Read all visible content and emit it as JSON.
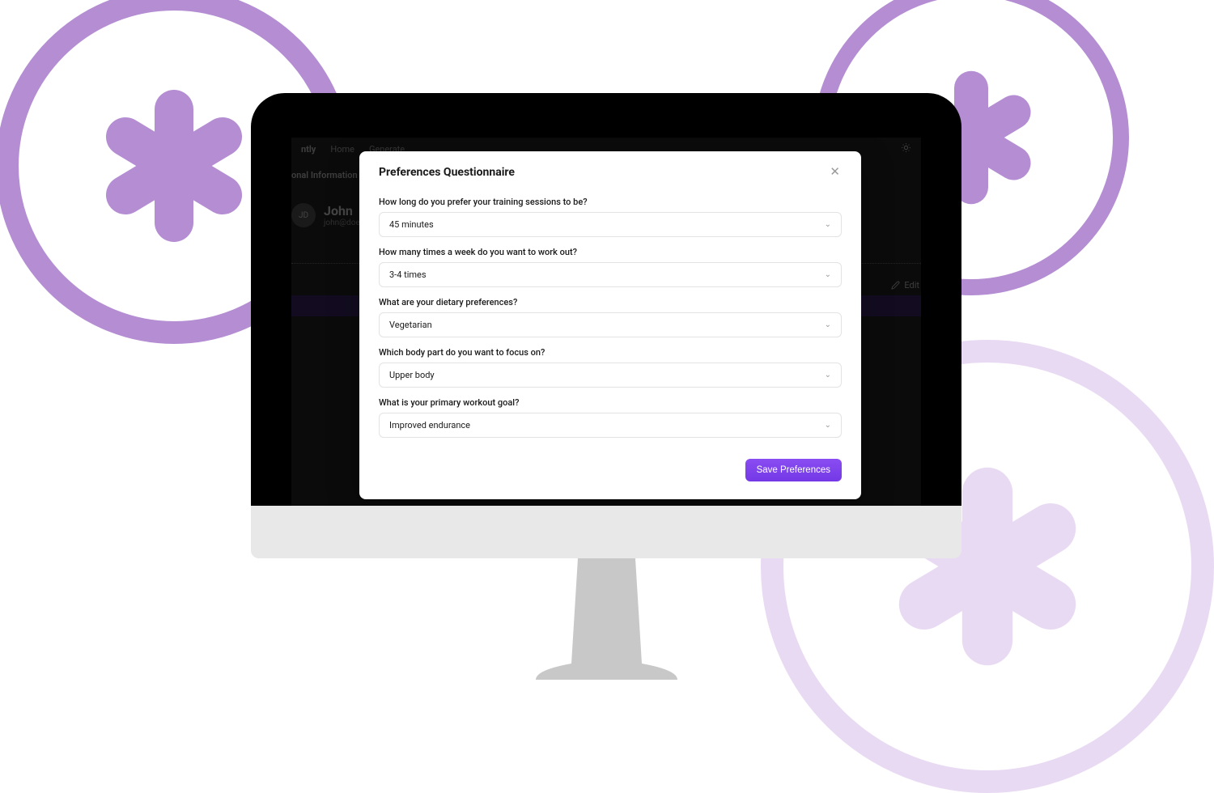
{
  "background_app": {
    "brand_suffix": "ntly",
    "nav": {
      "home": "Home",
      "generate": "Generate"
    },
    "section_label": "onal Information",
    "avatar_initials": "JD",
    "user_name": "John",
    "user_email": "john@doe-",
    "edit_label": "Edit"
  },
  "modal": {
    "title": "Preferences Questionnaire",
    "questions": [
      {
        "label": "How long do you prefer your training sessions to be?",
        "value": "45 minutes"
      },
      {
        "label": "How many times a week do you want to work out?",
        "value": "3-4 times"
      },
      {
        "label": "What are your dietary preferences?",
        "value": "Vegetarian"
      },
      {
        "label": "Which body part do you want to focus on?",
        "value": "Upper body"
      },
      {
        "label": "What is your primary workout goal?",
        "value": "Improved endurance"
      }
    ],
    "save_label": "Save Preferences"
  },
  "colors": {
    "accent": "#8a4df2",
    "decor_primary": "#b48dd3",
    "decor_light": "#e9daf4"
  }
}
